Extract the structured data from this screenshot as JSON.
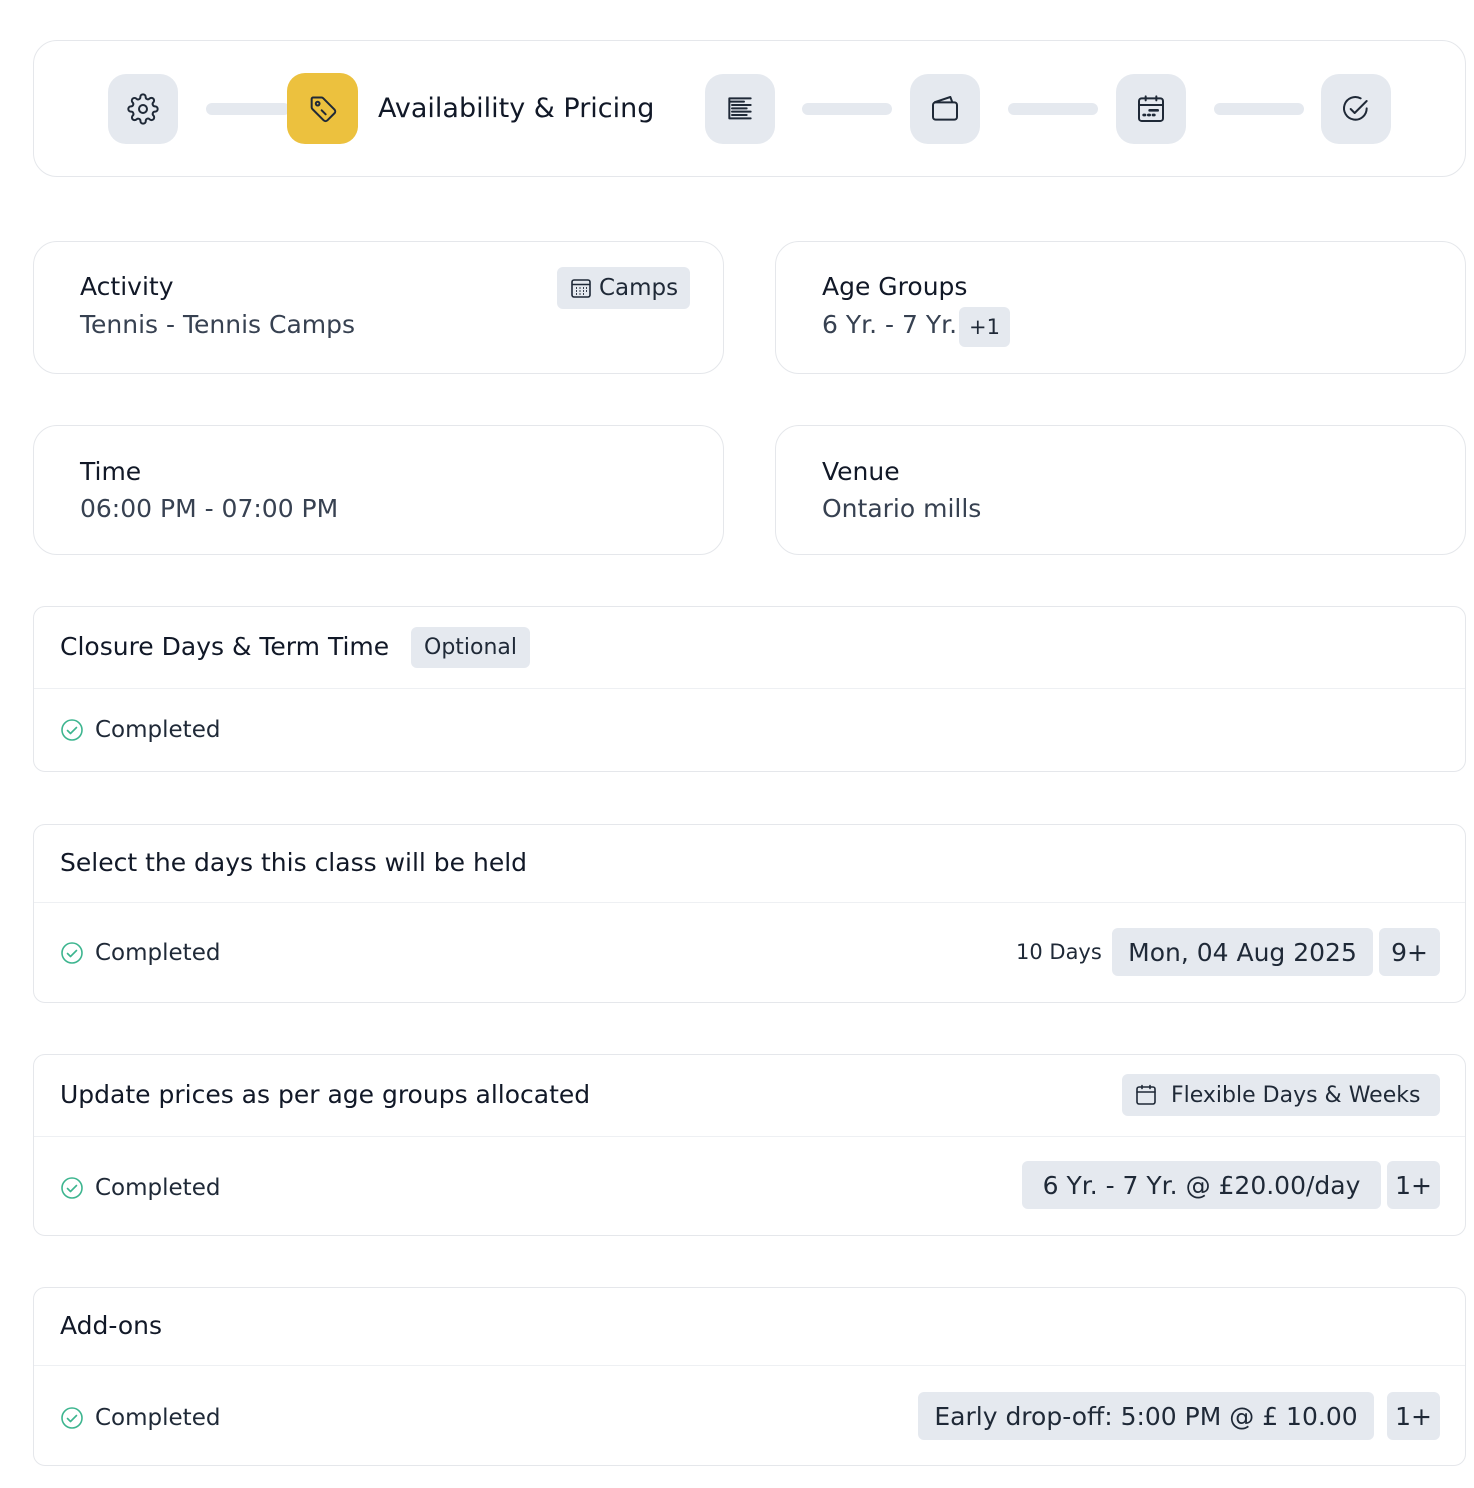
{
  "stepper": {
    "active_label": "Availability & Pricing",
    "steps": [
      {
        "icon": "gear-icon",
        "active": false
      },
      {
        "icon": "tag-icon",
        "active": true
      },
      {
        "icon": "list-icon",
        "active": false
      },
      {
        "icon": "wallet-icon",
        "active": false
      },
      {
        "icon": "calendar-icon",
        "active": false
      },
      {
        "icon": "check-circle-icon",
        "active": false
      }
    ]
  },
  "activity": {
    "title": "Activity",
    "value": "Tennis - Tennis Camps",
    "badge": "Camps"
  },
  "age_groups": {
    "title": "Age Groups",
    "value": "6 Yr. - 7 Yr.",
    "more": "+1"
  },
  "time": {
    "title": "Time",
    "value": "06:00 PM - 07:00 PM"
  },
  "venue": {
    "title": "Venue",
    "value": "Ontario mills"
  },
  "closure": {
    "title": "Closure Days & Term Time",
    "badge": "Optional",
    "status": "Completed"
  },
  "days": {
    "title": "Select the days this class will be held",
    "status": "Completed",
    "count": "10 Days",
    "date": "Mon, 04 Aug 2025",
    "more": "9+"
  },
  "prices": {
    "title": "Update prices as per age groups allocated",
    "mode": "Flexible Days & Weeks",
    "status": "Completed",
    "price": "6 Yr. - 7 Yr. @ £20.00/day",
    "more": "1+"
  },
  "addons": {
    "title": "Add-ons",
    "status": "Completed",
    "item": "Early drop-off: 5:00 PM @ £ 10.00",
    "more": "1+"
  },
  "colors": {
    "accent": "#ecc13e",
    "pill_bg": "#e5e9ef",
    "success": "#3db58f",
    "border": "#e5e7eb"
  }
}
